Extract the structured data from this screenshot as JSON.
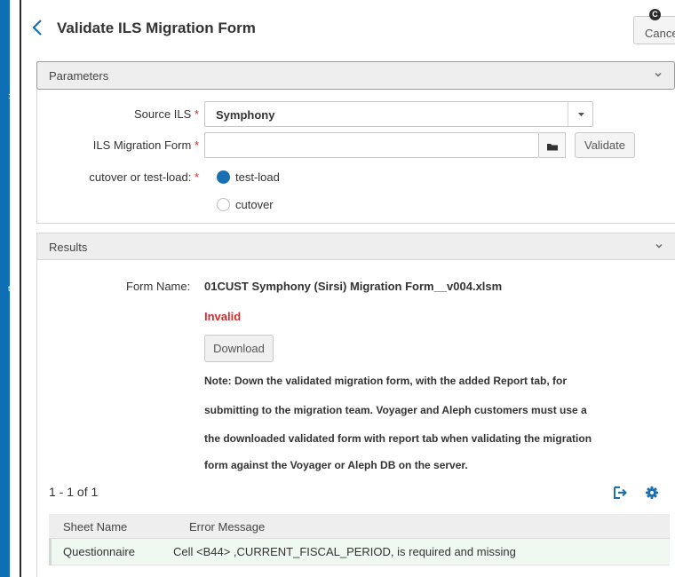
{
  "page": {
    "title": "Validate ILS Migration Form"
  },
  "header": {
    "cancel_label": "Cancel",
    "cancel_shortcut": "C"
  },
  "parameters": {
    "title": "Parameters",
    "source_ils": {
      "label": "Source ILS",
      "required_mark": "*",
      "value": "Symphony"
    },
    "migration_form": {
      "label": "ILS Migration Form",
      "required_mark": "*",
      "value": "",
      "validate_label": "Validate"
    },
    "mode": {
      "label": "cutover or test-load:",
      "required_mark": "*",
      "options": [
        {
          "label": "test-load",
          "selected": true
        },
        {
          "label": "cutover",
          "selected": false
        }
      ]
    }
  },
  "results": {
    "title": "Results",
    "form_name_label": "Form Name:",
    "form_name_value": "01CUST Symphony (Sirsi) Migration Form__v004.xlsm",
    "status": "Invalid",
    "download_label": "Download",
    "note_lines": [
      "Note: Down the validated migration form, with the added Report tab, for",
      "submitting to the migration team. Voyager and Aleph customers must use a",
      "the downloaded validated form with report tab when validating the migration",
      "form against the Voyager or Aleph DB on the server."
    ],
    "pager": "1 - 1 of 1",
    "table": {
      "columns": [
        "Sheet Name",
        "Error Message"
      ],
      "rows": [
        {
          "sheet": "Questionnaire",
          "message": "Cell <B44> ,CURRENT_FISCAL_PERIOD, is required and missing"
        }
      ]
    }
  },
  "colors": {
    "accent": "#1a6fb0",
    "error": "#d62b2b",
    "row_highlight": "#f0f8f2"
  },
  "icons": [
    "chevron-left-icon",
    "chevron-down-icon",
    "caret-down-icon",
    "folder-icon",
    "export-icon",
    "gear-icon"
  ]
}
